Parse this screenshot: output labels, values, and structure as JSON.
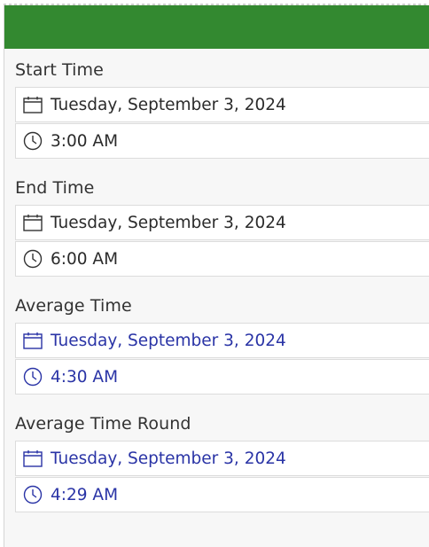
{
  "fields": [
    {
      "label": "Start Time",
      "date": "Tuesday, September 3, 2024",
      "time": "3:00 AM"
    },
    {
      "label": "End Time",
      "date": "Tuesday, September 3, 2024",
      "time": "6:00 AM"
    },
    {
      "label": "Average Time",
      "date": "Tuesday, September 3, 2024",
      "time": "4:30 AM"
    },
    {
      "label": "Average Time Round",
      "date": "Tuesday, September 3, 2024",
      "time": "4:29 AM"
    }
  ],
  "colors": {
    "header": "#338930",
    "editable_text": "#2b2b2b",
    "readonly_text": "#2a34a6"
  },
  "icons": {
    "date": "calendar-icon",
    "time": "clock-icon"
  }
}
